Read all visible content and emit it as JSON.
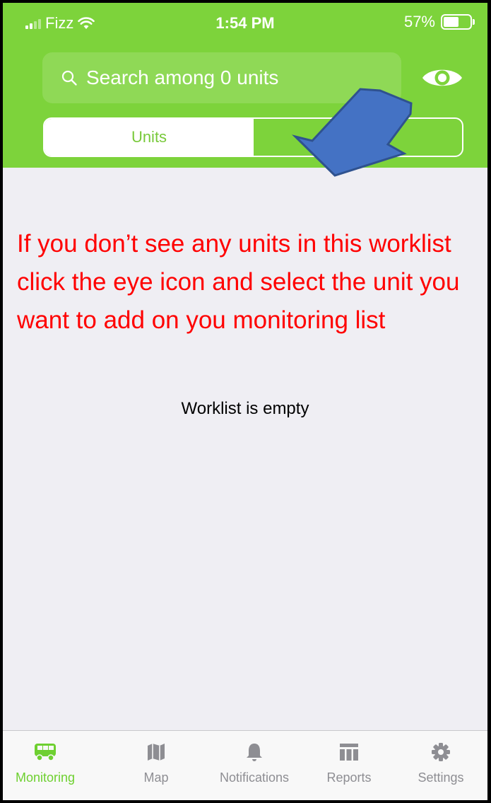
{
  "status_bar": {
    "carrier": "Fizz",
    "time": "1:54 PM",
    "battery": "57%",
    "battery_level": 0.57
  },
  "header": {
    "search_placeholder": "Search among 0 units",
    "segments": [
      {
        "label": "Units",
        "selected": true
      },
      {
        "label": "",
        "selected": false
      }
    ]
  },
  "annotation": {
    "text": "If you don’t see any units in this worklist click the eye icon and select the unit you want to add on you monitoring list"
  },
  "content": {
    "empty_message": "Worklist is empty"
  },
  "tabbar": {
    "tabs": [
      {
        "label": "Monitoring",
        "icon": "bus-icon",
        "active": true
      },
      {
        "label": "Map",
        "icon": "map-icon",
        "active": false
      },
      {
        "label": "Notifications",
        "icon": "bell-icon",
        "active": false
      },
      {
        "label": "Reports",
        "icon": "table-icon",
        "active": false
      },
      {
        "label": "Settings",
        "icon": "gear-icon",
        "active": false
      }
    ]
  },
  "colors": {
    "header_green": "#7dd33b",
    "accent_green": "#6ed030",
    "annotation_red": "#ff0000",
    "arrow_blue": "#4472c4"
  }
}
